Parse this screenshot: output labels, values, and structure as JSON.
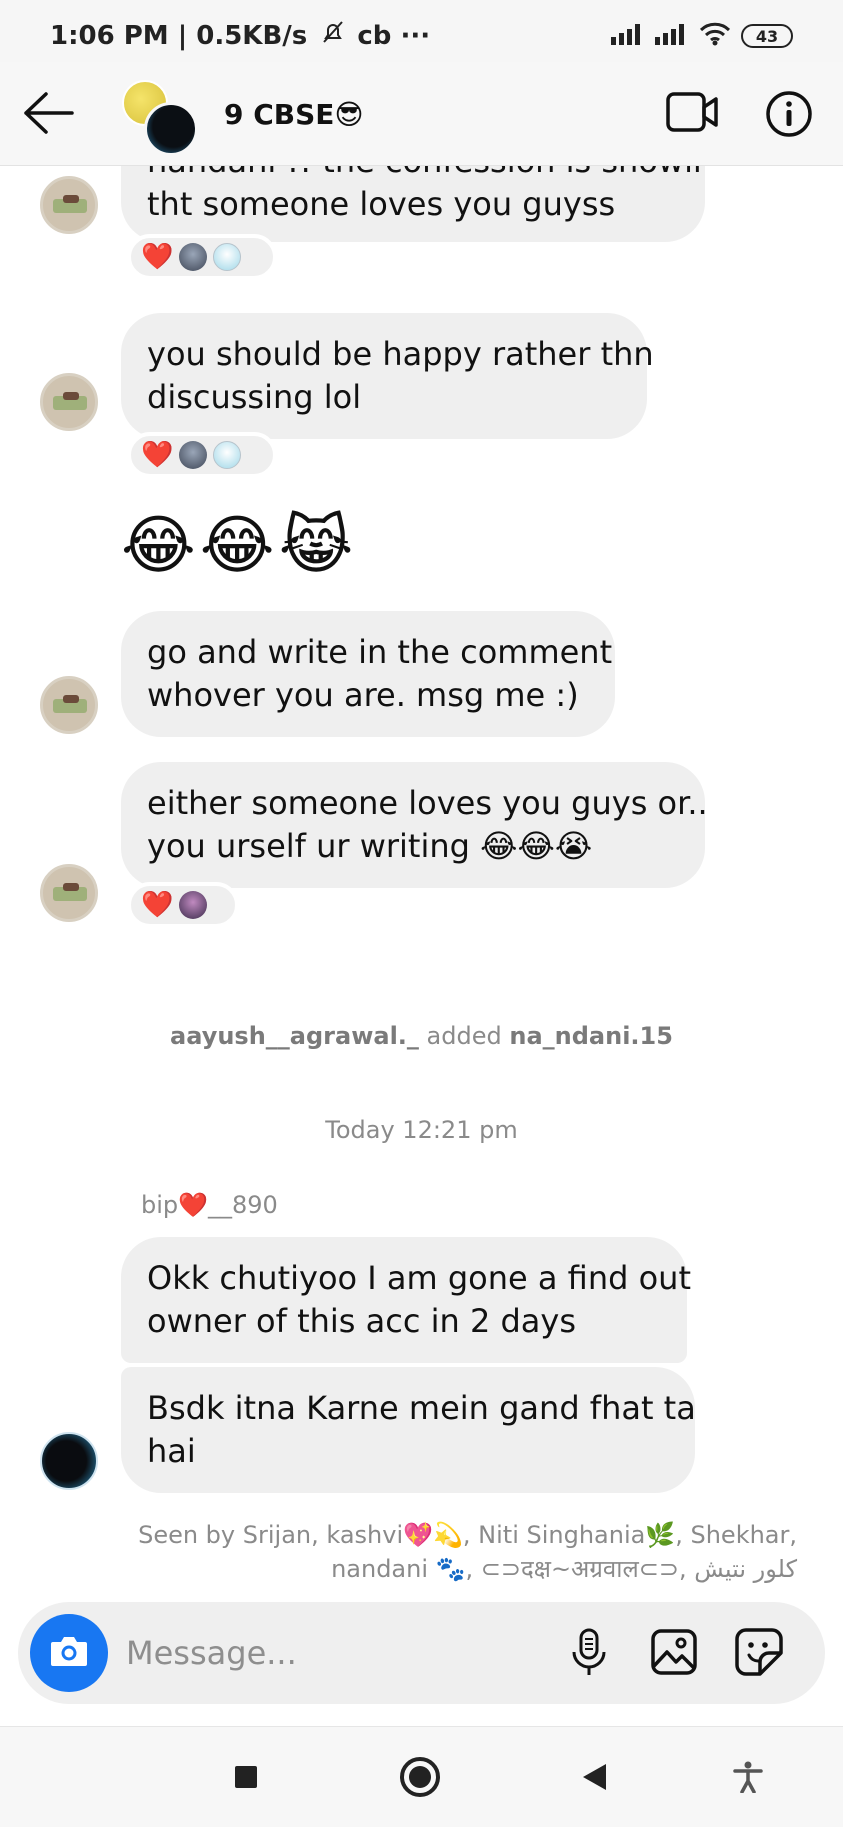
{
  "status_bar": {
    "time": "1:06 PM | 0.5KB/s",
    "extra": "cb ···",
    "battery": "43"
  },
  "header": {
    "title": "9 CBSE😎"
  },
  "messages": [
    {
      "partial_text": "nandani !! the confession is showing",
      "lines": [
        "tht someone loves you guyss"
      ]
    },
    {
      "lines": [
        "you should be happy rather thn",
        "discussing lol"
      ]
    },
    {
      "emoji_row": "😂😂😹"
    },
    {
      "lines": [
        "go and write in the comment",
        "whover you are. msg me :)"
      ]
    },
    {
      "lines": [
        "either someone loves you guys or..",
        "you urself ur writing 😂😂😭"
      ]
    },
    {
      "lines": [
        "Okk chutiyoo I am gone a find out",
        "owner of this acc in 2 days"
      ]
    },
    {
      "lines": [
        "Bsdk itna Karne mein gand fhat ta",
        "hai"
      ]
    }
  ],
  "reactions": {
    "heart": "❤️"
  },
  "system": {
    "added_actor": "aayush__agrawal._",
    "added_verb": " added ",
    "added_target": "na_ndani.15",
    "timestamp": "Today 12:21 pm"
  },
  "sender": {
    "name": "bip❤️__890"
  },
  "seen": {
    "line1": "Seen by Srijan, kashvi💖💫, Niti Singhania🌿, Shekhar,",
    "line2": "nandani 🐾, ⊂⊃दक्ष~अग्रवाल⊂⊃, کلور نتیش"
  },
  "composer": {
    "placeholder": "Message..."
  },
  "icons": {
    "back": "arrow-left-icon",
    "video": "video-camera-icon",
    "info": "info-icon",
    "camera": "camera-icon",
    "mic": "microphone-icon",
    "gallery": "image-icon",
    "sticker": "sticker-icon",
    "nav_recent": "square-icon",
    "nav_home": "circle-icon",
    "nav_back": "triangle-back-icon",
    "accessibility": "accessibility-icon"
  },
  "colors": {
    "accent_blue": "#1877f2",
    "bubble_gray": "#efefef",
    "heart_red": "#e0142f",
    "meta_gray": "#8a8a8a"
  }
}
